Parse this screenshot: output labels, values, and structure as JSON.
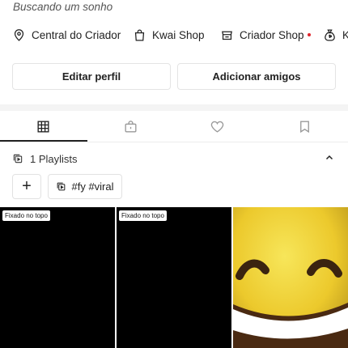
{
  "profile": {
    "bio": "Buscando um sonho"
  },
  "shortcuts": [
    {
      "label": "Central do Criador",
      "icon": "location-pin-icon"
    },
    {
      "label": "Kwai Shop",
      "icon": "shopping-bag-icon"
    },
    {
      "label": "Criador Shop",
      "icon": "storefront-icon",
      "badge_color": "#e0262e"
    },
    {
      "label": "K",
      "icon": "money-bag-icon"
    }
  ],
  "actions": {
    "edit_profile": "Editar perfil",
    "add_friends": "Adicionar amigos"
  },
  "tabs": [
    {
      "name": "grid",
      "icon": "grid-icon",
      "active": true
    },
    {
      "name": "private",
      "icon": "lock-bag-icon",
      "active": false
    },
    {
      "name": "likes",
      "icon": "heart-icon",
      "active": false
    },
    {
      "name": "saved",
      "icon": "bookmark-icon",
      "active": false
    }
  ],
  "playlists": {
    "label": "1 Playlists",
    "items": [
      "#fy #viral"
    ],
    "add_symbol": "+"
  },
  "videos": [
    {
      "pinned_label": "Fixado no topo",
      "thumbnail": "black"
    },
    {
      "pinned_label": "Fixado no topo",
      "thumbnail": "black"
    },
    {
      "pinned_label": "",
      "thumbnail": "laughing-emoji"
    }
  ],
  "colors": {
    "accent_red": "#e0262e",
    "emoji_yellow": "#f2d637"
  }
}
